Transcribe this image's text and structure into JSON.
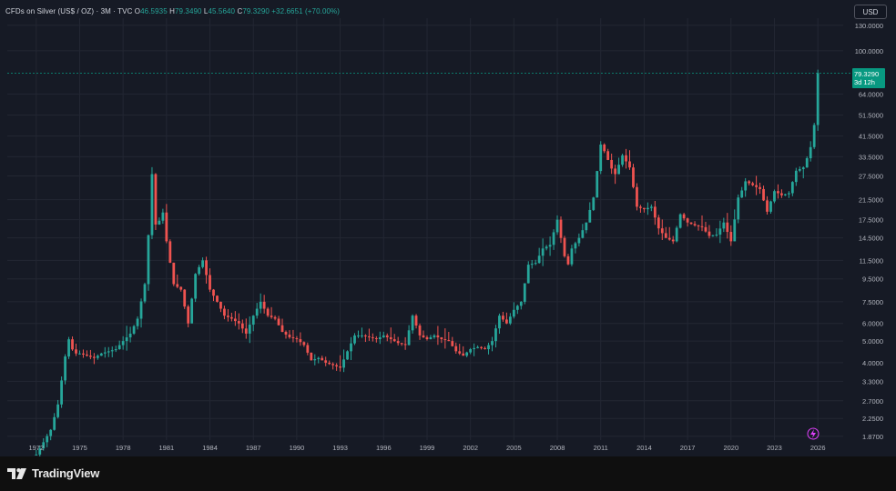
{
  "header": {
    "symbol": "CFDs on Silver (US$ / OZ) · 3M · TVC",
    "open_label": "O",
    "open": "46.5935",
    "high_label": "H",
    "high": "79.3490",
    "low_label": "L",
    "low": "45.5640",
    "close_label": "C",
    "close": "79.3290",
    "change": "+32.6651 (+70.00%)"
  },
  "currency_button": "USD",
  "price_tag": {
    "price": "79.3290",
    "countdown": "3d 12h"
  },
  "brand": "TradingView",
  "colors": {
    "up": "#26a69a",
    "down": "#ef5350",
    "background": "#161a25",
    "grid": "#232733",
    "axis_text": "#b2b5be",
    "price_line": "#089981"
  },
  "chart_data": {
    "type": "candlestick",
    "y_scale": "log",
    "ylim": [
      1.8,
      140
    ],
    "xlim": [
      1970.0,
      2027.5
    ],
    "x_ticks": [
      "1972",
      "1975",
      "1978",
      "1981",
      "1984",
      "1987",
      "1990",
      "1993",
      "1996",
      "1999",
      "2002",
      "2005",
      "2008",
      "2011",
      "2014",
      "2017",
      "2020",
      "2023",
      "2026"
    ],
    "y_ticks": [
      "130.0000",
      "100.0000",
      "64.0000",
      "51.5000",
      "41.5000",
      "33.5000",
      "27.5000",
      "21.5000",
      "17.5000",
      "14.5000",
      "11.5000",
      "9.5000",
      "7.5000",
      "6.0000",
      "5.0000",
      "4.0000",
      "3.3000",
      "2.7000",
      "2.2500",
      "1.8700"
    ],
    "last_price": 79.329,
    "keypoints": [
      [
        1972.0,
        1.55
      ],
      [
        1973.0,
        2.0
      ],
      [
        1973.5,
        2.6
      ],
      [
        1974.2,
        5.2
      ],
      [
        1974.6,
        4.4
      ],
      [
        1975.0,
        4.4
      ],
      [
        1975.5,
        4.3
      ],
      [
        1976.0,
        4.2
      ],
      [
        1976.5,
        4.4
      ],
      [
        1977.0,
        4.5
      ],
      [
        1977.5,
        4.6
      ],
      [
        1978.0,
        5.0
      ],
      [
        1978.5,
        5.4
      ],
      [
        1979.0,
        6.3
      ],
      [
        1979.5,
        9.0
      ],
      [
        1979.8,
        16.5
      ],
      [
        1980.0,
        28.0
      ],
      [
        1980.3,
        15.0
      ],
      [
        1980.7,
        20.0
      ],
      [
        1981.0,
        14.0
      ],
      [
        1981.5,
        9.0
      ],
      [
        1982.0,
        8.5
      ],
      [
        1982.5,
        6.0
      ],
      [
        1983.0,
        10.0
      ],
      [
        1983.5,
        11.5
      ],
      [
        1984.0,
        8.5
      ],
      [
        1984.5,
        7.5
      ],
      [
        1985.0,
        6.5
      ],
      [
        1985.5,
        6.3
      ],
      [
        1986.0,
        6.0
      ],
      [
        1986.5,
        5.4
      ],
      [
        1987.0,
        6.5
      ],
      [
        1987.5,
        7.5
      ],
      [
        1988.0,
        6.5
      ],
      [
        1988.5,
        6.3
      ],
      [
        1989.0,
        5.5
      ],
      [
        1989.5,
        5.2
      ],
      [
        1990.0,
        5.1
      ],
      [
        1990.5,
        4.8
      ],
      [
        1991.0,
        4.1
      ],
      [
        1991.5,
        4.2
      ],
      [
        1992.0,
        4.0
      ],
      [
        1992.5,
        3.9
      ],
      [
        1993.0,
        3.8
      ],
      [
        1993.5,
        4.5
      ],
      [
        1994.0,
        5.3
      ],
      [
        1994.5,
        5.3
      ],
      [
        1995.0,
        5.2
      ],
      [
        1995.5,
        5.1
      ],
      [
        1996.0,
        5.3
      ],
      [
        1996.5,
        5.1
      ],
      [
        1997.0,
        4.9
      ],
      [
        1997.5,
        4.8
      ],
      [
        1998.0,
        6.5
      ],
      [
        1998.5,
        5.3
      ],
      [
        1999.0,
        5.1
      ],
      [
        1999.5,
        5.3
      ],
      [
        2000.0,
        5.1
      ],
      [
        2000.5,
        5.0
      ],
      [
        2001.0,
        4.5
      ],
      [
        2001.5,
        4.3
      ],
      [
        2002.0,
        4.6
      ],
      [
        2002.5,
        4.7
      ],
      [
        2003.0,
        4.6
      ],
      [
        2003.5,
        5.0
      ],
      [
        2004.0,
        6.5
      ],
      [
        2004.5,
        6.0
      ],
      [
        2005.0,
        6.9
      ],
      [
        2005.5,
        7.5
      ],
      [
        2006.0,
        11.0
      ],
      [
        2006.5,
        11.2
      ],
      [
        2007.0,
        13.0
      ],
      [
        2007.5,
        13.5
      ],
      [
        2008.0,
        17.5
      ],
      [
        2008.5,
        12.0
      ],
      [
        2008.9,
        10.5
      ],
      [
        2009.0,
        13.0
      ],
      [
        2009.5,
        14.5
      ],
      [
        2010.0,
        17.0
      ],
      [
        2010.5,
        22.0
      ],
      [
        2011.0,
        38.0
      ],
      [
        2011.3,
        35.0
      ],
      [
        2011.7,
        30.0
      ],
      [
        2012.0,
        28.0
      ],
      [
        2012.5,
        34.0
      ],
      [
        2013.0,
        30.0
      ],
      [
        2013.5,
        20.0
      ],
      [
        2014.0,
        19.5
      ],
      [
        2014.5,
        20.0
      ],
      [
        2015.0,
        16.0
      ],
      [
        2015.5,
        14.5
      ],
      [
        2016.0,
        14.0
      ],
      [
        2016.5,
        18.5
      ],
      [
        2017.0,
        17.0
      ],
      [
        2017.5,
        16.5
      ],
      [
        2018.0,
        16.2
      ],
      [
        2018.5,
        14.8
      ],
      [
        2019.0,
        15.0
      ],
      [
        2019.5,
        17.0
      ],
      [
        2020.0,
        14.0
      ],
      [
        2020.5,
        22.0
      ],
      [
        2020.8,
        24.0
      ],
      [
        2021.0,
        26.0
      ],
      [
        2021.5,
        25.0
      ],
      [
        2022.0,
        24.0
      ],
      [
        2022.5,
        19.0
      ],
      [
        2023.0,
        23.5
      ],
      [
        2023.5,
        22.5
      ],
      [
        2024.0,
        23.0
      ],
      [
        2024.5,
        29.0
      ],
      [
        2025.0,
        30.0
      ],
      [
        2025.25,
        33.0
      ],
      [
        2025.5,
        37.0
      ],
      [
        2025.75,
        46.5
      ],
      [
        2026.0,
        79.33
      ]
    ]
  }
}
